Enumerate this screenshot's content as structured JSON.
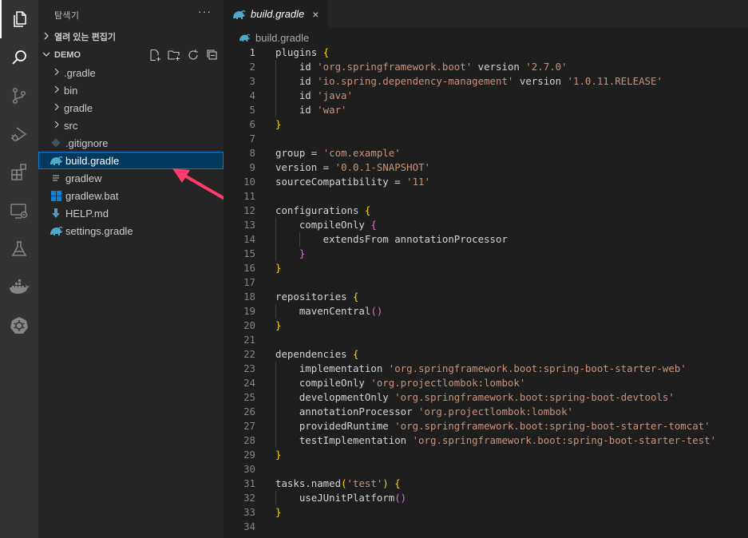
{
  "sidebar": {
    "title": "탐색기",
    "more": "···",
    "open_editors": "열려 있는 편집기",
    "project": "DEMO",
    "items": [
      {
        "label": ".gradle",
        "kind": "folder"
      },
      {
        "label": "bin",
        "kind": "folder"
      },
      {
        "label": "gradle",
        "kind": "folder"
      },
      {
        "label": "src",
        "kind": "folder"
      },
      {
        "label": ".gitignore",
        "kind": "gitignore"
      },
      {
        "label": "build.gradle",
        "kind": "gradle",
        "selected": true
      },
      {
        "label": "gradlew",
        "kind": "text"
      },
      {
        "label": "gradlew.bat",
        "kind": "windows"
      },
      {
        "label": "HELP.md",
        "kind": "markdown"
      },
      {
        "label": "settings.gradle",
        "kind": "gradle"
      }
    ]
  },
  "editor": {
    "tab_label": "build.gradle",
    "tab_close": "×",
    "breadcrumb": "build.gradle",
    "current_line": 1
  },
  "code_lines": [
    "plugins {",
    "    id 'org.springframework.boot' version '2.7.0'",
    "    id 'io.spring.dependency-management' version '1.0.11.RELEASE'",
    "    id 'java'",
    "    id 'war'",
    "}",
    "",
    "group = 'com.example'",
    "version = '0.0.1-SNAPSHOT'",
    "sourceCompatibility = '11'",
    "",
    "configurations {",
    "    compileOnly {",
    "        extendsFrom annotationProcessor",
    "    }",
    "}",
    "",
    "repositories {",
    "    mavenCentral()",
    "}",
    "",
    "dependencies {",
    "    implementation 'org.springframework.boot:spring-boot-starter-web'",
    "    compileOnly 'org.projectlombok:lombok'",
    "    developmentOnly 'org.springframework.boot:spring-boot-devtools'",
    "    annotationProcessor 'org.projectlombok:lombok'",
    "    providedRuntime 'org.springframework.boot:spring-boot-starter-tomcat'",
    "    testImplementation 'org.springframework.boot:spring-boot-starter-test'",
    "}",
    "",
    "tasks.named('test') {",
    "    useJUnitPlatform()",
    "}",
    ""
  ],
  "colors": {
    "accent_arrow": "#ff3b6b",
    "gradle_icon": "#4fa9c9",
    "selection_bg": "#04395e"
  },
  "icons": {
    "activity_bar": [
      "files-icon",
      "search-icon",
      "source-control-icon",
      "run-debug-icon",
      "extensions-icon",
      "remote-explorer-icon",
      "testing-icon",
      "docker-icon",
      "kubernetes-icon"
    ],
    "explorer_actions": [
      "new-file-icon",
      "new-folder-icon",
      "refresh-icon",
      "collapse-all-icon"
    ]
  }
}
